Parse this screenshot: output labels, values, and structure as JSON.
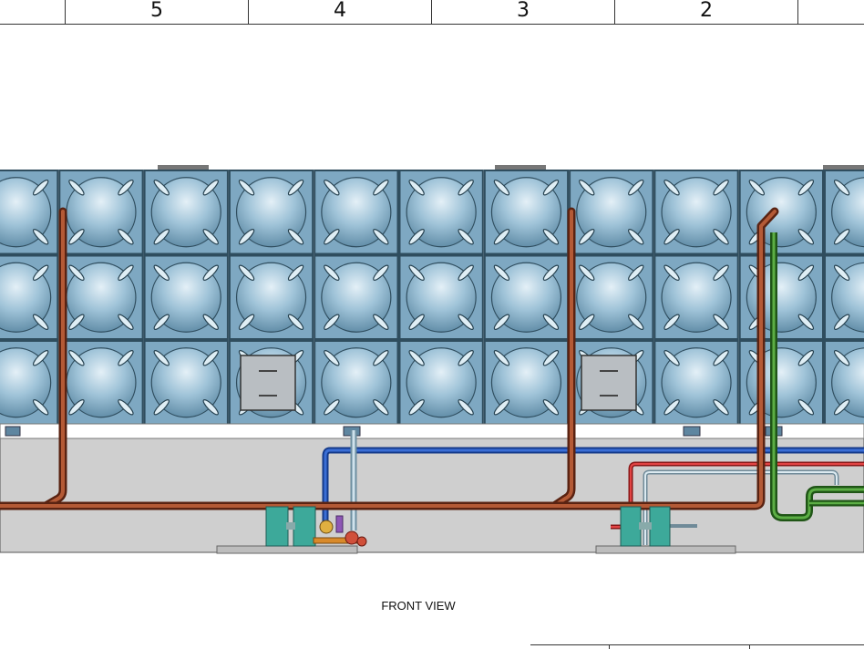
{
  "border_zones": [
    "5",
    "4",
    "3",
    "2"
  ],
  "view_label": "FRONT VIEW",
  "tank": {
    "rows": 3,
    "columns": 11,
    "inspection_hatches": 2,
    "roof_vents": 3
  },
  "colors": {
    "panel": "#8fb6cf",
    "panel_edge": "#3c5a6c",
    "hot_pipe": "#a84a2c",
    "blue_pipe": "#1e4fb0",
    "red_pipe": "#cc2a2a",
    "green_pipe": "#3f8c2e",
    "light_pipe": "#a7c6d6",
    "pump": "#3da99a",
    "plinth": "#c8c8c8"
  }
}
